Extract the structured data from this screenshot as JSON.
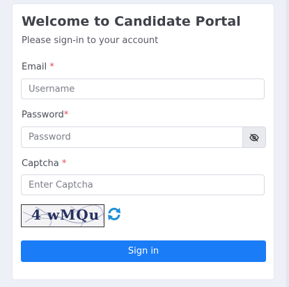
{
  "header": {
    "title": "Welcome to Candidate Portal",
    "subtitle": "Please sign-in to your account"
  },
  "email": {
    "label": "Email",
    "required_mark": "*",
    "placeholder": "Username"
  },
  "password": {
    "label": "Password",
    "required_mark": "*",
    "placeholder": "Password",
    "toggle_icon": "eye-slash-icon"
  },
  "captcha": {
    "label": "Captcha",
    "required_mark": "*",
    "placeholder": "Enter Captcha",
    "image_text": "4 wMQu",
    "refresh_icon": "refresh-icon"
  },
  "actions": {
    "signin_label": "Sign in"
  },
  "colors": {
    "primary": "#1a7cf6",
    "required": "#e24a5a",
    "refresh": "#1e8fd8"
  }
}
